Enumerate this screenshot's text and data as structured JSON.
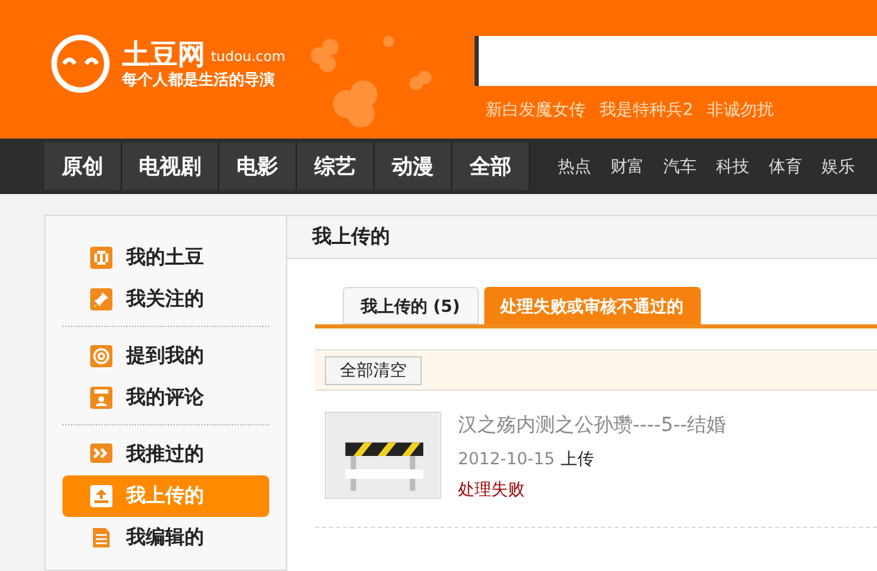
{
  "header": {
    "logo": {
      "name": "土豆网",
      "domain": "tudou.com",
      "slogan": "每个人都是生活的导演"
    },
    "hot_links": [
      "新白发魔女传",
      "我是特种兵2",
      "非诚勿扰"
    ]
  },
  "nav": {
    "main": [
      {
        "label": "原创"
      },
      {
        "label": "电视剧"
      },
      {
        "label": "电影"
      },
      {
        "label": "综艺"
      },
      {
        "label": "动漫"
      },
      {
        "label": "全部"
      }
    ],
    "channels": [
      "热点",
      "财富",
      "汽车",
      "科技",
      "体育",
      "娱乐"
    ]
  },
  "sidebar": {
    "groups": [
      [
        {
          "label": "我的土豆",
          "kind": "grid",
          "selected": false
        },
        {
          "label": "我关注的",
          "kind": "pin",
          "selected": false
        }
      ],
      [
        {
          "label": "提到我的",
          "kind": "at",
          "selected": false
        },
        {
          "label": "我的评论",
          "kind": "comment",
          "selected": false
        }
      ],
      [
        {
          "label": "我推过的",
          "kind": "push",
          "selected": false
        },
        {
          "label": "我上传的",
          "kind": "upload",
          "selected": true
        },
        {
          "label": "我编辑的",
          "kind": "doc",
          "selected": false
        }
      ]
    ]
  },
  "main": {
    "title": "我上传的",
    "tabs": [
      {
        "label": "我上传的 (5)",
        "selected": false
      },
      {
        "label": "处理失败或审核不通过的",
        "selected": true
      }
    ],
    "clear_button": "全部清空",
    "videos": [
      {
        "title": "汉之殇内测之公孙瓒----5--结婚",
        "date": "2012-10-15",
        "action": "上传",
        "status": "处理失败"
      }
    ]
  }
}
